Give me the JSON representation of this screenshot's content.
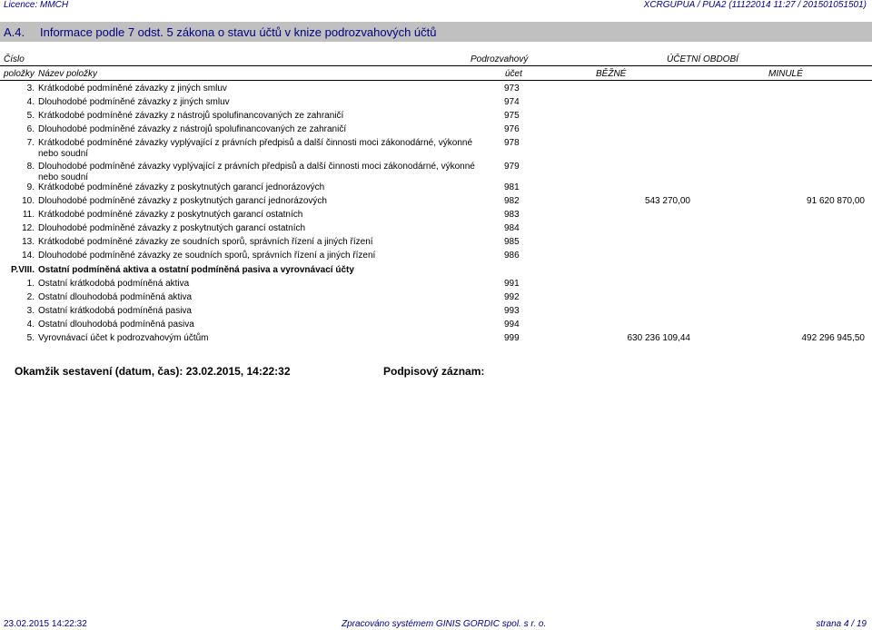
{
  "top": {
    "licence": "Licence: MMCH",
    "right": "XCRGUPUA / PUA2 (11122014 11:27 / 201501051501)"
  },
  "title": {
    "number": "A.4.",
    "text": "Informace podle 7 odst. 5 zákona o stavu účtů v knize podrozvahových účtů"
  },
  "header": {
    "cislo": "Číslo",
    "polozky": "položky",
    "nazev": "Název položky",
    "podrozvahovy": "Podrozvahový",
    "ucet": "účet",
    "ucetni_obdobi": "ÚČETNÍ OBDOBÍ",
    "bezne": "BĚŽNÉ",
    "minule": "MINULÉ"
  },
  "rows": [
    {
      "num": "3.",
      "text": "Krátkodobé podmíněné závazky z jiných smluv",
      "acct": "973",
      "cur": "",
      "prev": ""
    },
    {
      "num": "4.",
      "text": "Dlouhodobé podmíněné závazky z jiných smluv",
      "acct": "974",
      "cur": "",
      "prev": ""
    },
    {
      "num": "5.",
      "text": "Krátkodobé podmíněné závazky z nástrojů spolufinancovaných ze zahraničí",
      "acct": "975",
      "cur": "",
      "prev": ""
    },
    {
      "num": "6.",
      "text": "Dlouhodobé podmíněné závazky z nástrojů spolufinancovaných ze zahraničí",
      "acct": "976",
      "cur": "",
      "prev": ""
    },
    {
      "num": "7.",
      "text": "Krátkodobé podmíněné závazky vyplývající z právních předpisů a další činnosti moci zákonodárné, výkonné nebo soudní",
      "acct": "978",
      "cur": "",
      "prev": ""
    },
    {
      "num": "8.",
      "text": "Dlouhodobé podmíněné závazky vyplývající z právních předpisů a další činnosti moci zákonodárné, výkonné nebo soudní",
      "acct": "979",
      "cur": "",
      "prev": ""
    },
    {
      "num": "9.",
      "text": "Krátkodobé podmíněné závazky z poskytnutých garancí jednorázových",
      "acct": "981",
      "cur": "",
      "prev": ""
    },
    {
      "num": "10.",
      "text": "Dlouhodobé podmíněné závazky z poskytnutých garancí jednorázových",
      "acct": "982",
      "cur": "543 270,00",
      "prev": "91 620 870,00"
    },
    {
      "num": "11.",
      "text": "Krátkodobé podmíněné závazky z poskytnutých garancí ostatních",
      "acct": "983",
      "cur": "",
      "prev": ""
    },
    {
      "num": "12.",
      "text": "Dlouhodobé podmíněné závazky z poskytnutých garancí ostatních",
      "acct": "984",
      "cur": "",
      "prev": ""
    },
    {
      "num": "13.",
      "text": "Krátkodobé podmíněné závazky ze soudních sporů, správních řízení a jiných řízení",
      "acct": "985",
      "cur": "",
      "prev": ""
    },
    {
      "num": "14.",
      "text": "Dlouhodobé podmíněné závazky ze soudních sporů, správních řízení a jiných řízení",
      "acct": "986",
      "cur": "",
      "prev": ""
    },
    {
      "num": "P.VIII.",
      "text": "Ostatní podmíněná aktiva a ostatní podmíněná pasiva a vyrovnávací účty",
      "acct": "",
      "cur": "",
      "prev": "",
      "bold": true
    },
    {
      "num": "1.",
      "text": "Ostatní krátkodobá podmíněná aktiva",
      "acct": "991",
      "cur": "",
      "prev": ""
    },
    {
      "num": "2.",
      "text": "Ostatní dlouhodobá podmíněná aktiva",
      "acct": "992",
      "cur": "",
      "prev": ""
    },
    {
      "num": "3.",
      "text": "Ostatní krátkodobá podmíněná pasiva",
      "acct": "993",
      "cur": "",
      "prev": ""
    },
    {
      "num": "4.",
      "text": "Ostatní dlouhodobá podmíněná pasiva",
      "acct": "994",
      "cur": "",
      "prev": ""
    },
    {
      "num": "5.",
      "text": "Vyrovnávací účet k podrozvahovým účtům",
      "acct": "999",
      "cur": "630 236 109,44",
      "prev": "492 296 945,50"
    }
  ],
  "signature": {
    "moment": "Okamžik sestavení (datum, čas): 23.02.2015, 14:22:32",
    "podpis": "Podpisový záznam:"
  },
  "footer": {
    "datetime": "23.02.2015 14:22:32",
    "system": "Zpracováno systémem  GINIS GORDIC spol. s  r. o.",
    "page": "strana 4 / 19"
  }
}
